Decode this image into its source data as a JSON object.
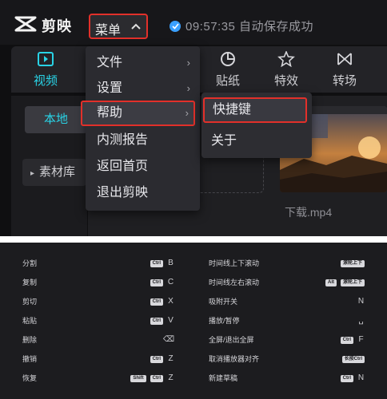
{
  "app": {
    "name": "剪映"
  },
  "menu_button": {
    "label": "菜单"
  },
  "status": {
    "text": "09:57:35 自动保存成功"
  },
  "tools": [
    {
      "label": "视频",
      "icon": "video-icon"
    },
    {
      "label": "贴纸",
      "icon": "sticker-icon"
    },
    {
      "label": "特效",
      "icon": "effects-icon"
    },
    {
      "label": "转场",
      "icon": "transition-icon"
    }
  ],
  "sidebar": {
    "local": "本地",
    "library": "素材库"
  },
  "menu_items": [
    {
      "label": "文件",
      "submenu": true
    },
    {
      "label": "设置",
      "submenu": true
    },
    {
      "label": "帮助",
      "submenu": true
    },
    {
      "label": "内测报告",
      "submenu": false
    },
    {
      "label": "返回首页",
      "submenu": false
    },
    {
      "label": "退出剪映",
      "submenu": false
    }
  ],
  "submenu_items": [
    {
      "label": "快捷键"
    },
    {
      "label": "关于"
    }
  ],
  "media": {
    "filename": "下载.mp4"
  },
  "shortcuts_left": [
    {
      "name": "分割",
      "badges": [
        "Ctrl"
      ],
      "key": "B"
    },
    {
      "name": "复制",
      "badges": [
        "Ctrl"
      ],
      "key": "C"
    },
    {
      "name": "剪切",
      "badges": [
        "Ctrl"
      ],
      "key": "X"
    },
    {
      "name": "粘贴",
      "badges": [
        "Ctrl"
      ],
      "key": "V"
    },
    {
      "name": "删除",
      "badges": [],
      "key": "⌫"
    },
    {
      "name": "撤销",
      "badges": [
        "Ctrl"
      ],
      "key": "Z"
    },
    {
      "name": "恢复",
      "badges": [
        "Shift",
        "Ctrl"
      ],
      "key": "Z"
    }
  ],
  "shortcuts_right": [
    {
      "name": "时间线上下滚动",
      "badges": [
        "滚轮上下"
      ],
      "key": ""
    },
    {
      "name": "时间线左右滚动",
      "badges": [
        "Alt",
        "滚轮上下"
      ],
      "key": ""
    },
    {
      "name": "吸附开关",
      "badges": [],
      "key": "N"
    },
    {
      "name": "播放/暂停",
      "badges": [],
      "key": "␣"
    },
    {
      "name": "全屏/退出全屏",
      "badges": [
        "Ctrl"
      ],
      "key": "F"
    },
    {
      "name": "取消播放器对齐",
      "badges": [
        "长按Ctrl"
      ],
      "key": ""
    },
    {
      "name": "新建草稿",
      "badges": [
        "Ctrl"
      ],
      "key": "N"
    }
  ]
}
